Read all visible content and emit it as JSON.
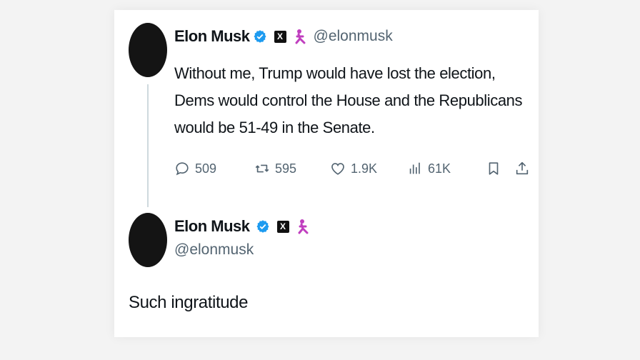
{
  "tweet1": {
    "display_name": "Elon Musk",
    "handle": "@elonmusk",
    "affiliate_badge": "X",
    "text": "Without me, Trump would have lost the election, Dems would control the House and the Republicans would be 51-49 in the Senate.",
    "stats": {
      "replies": "509",
      "reposts": "595",
      "likes": "1.9K",
      "views": "61K"
    }
  },
  "tweet2": {
    "display_name": "Elon Musk",
    "handle": "@elonmusk",
    "affiliate_badge": "X",
    "text": "Such ingratitude"
  },
  "icons": {
    "verified": "verified-badge-icon",
    "affiliate": "x-logo-icon",
    "emoji": "person-emoji-icon",
    "reply": "reply-icon",
    "repost": "repost-icon",
    "like": "heart-icon",
    "views": "views-icon",
    "bookmark": "bookmark-icon",
    "share": "share-icon"
  },
  "colors": {
    "verified_blue": "#1d9bf0",
    "text_primary": "#0f1419",
    "text_secondary": "#536471",
    "emoji_magenta": "#c03fbf"
  }
}
